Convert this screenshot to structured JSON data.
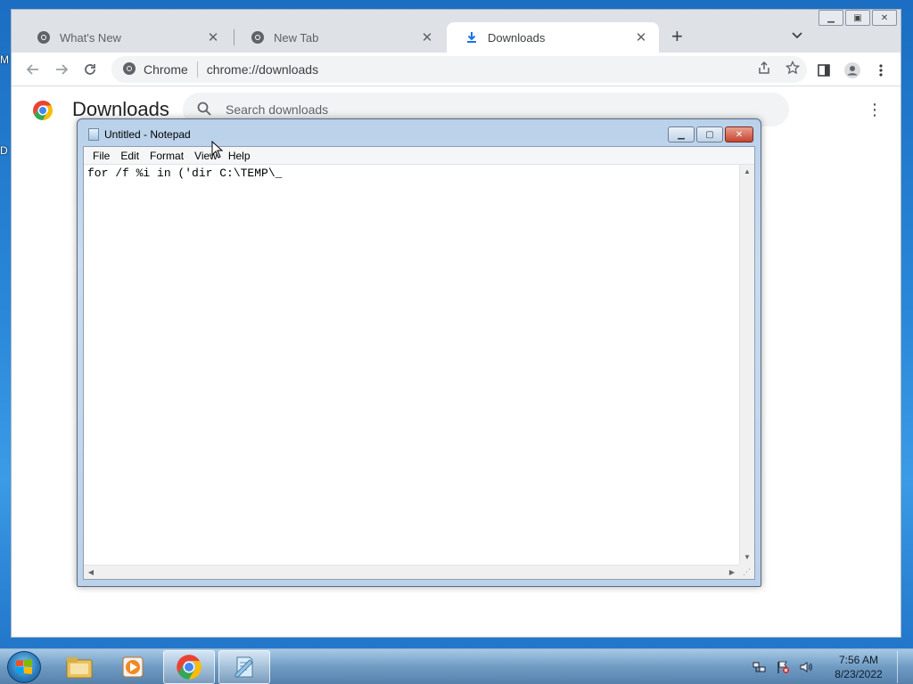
{
  "chrome": {
    "tabs": [
      {
        "label": "What's New",
        "icon": "chrome-icon",
        "active": false
      },
      {
        "label": "New Tab",
        "icon": "chrome-icon",
        "active": false
      },
      {
        "label": "Downloads",
        "icon": "download-icon",
        "active": true
      }
    ],
    "close_glyph": "✕",
    "new_tab_glyph": "+",
    "tab_search_glyph": "⌄",
    "omnibox": {
      "site_label": "Chrome",
      "url": "chrome://downloads"
    }
  },
  "downloads": {
    "title": "Downloads",
    "search_placeholder": "Search downloads",
    "menu_glyph": "⋮"
  },
  "notepad": {
    "title": "Untitled - Notepad",
    "menu": [
      "File",
      "Edit",
      "Format",
      "View",
      "Help"
    ],
    "text": "for /f %i in ('dir C:\\TEMP\\_"
  },
  "taskbar": {
    "items": [
      "file-explorer-icon",
      "media-player-icon",
      "chrome-icon",
      "notepad-icon"
    ],
    "active_items": [
      "chrome-icon",
      "notepad-icon"
    ],
    "clock_time": "7:56 AM",
    "clock_date": "8/23/2022"
  },
  "desktop": {
    "peek_letters": [
      "M",
      "D"
    ]
  },
  "colors": {
    "chrome_tabstrip": "#dee1e6",
    "chrome_download_accent": "#1a73e8",
    "notepad_close": "#c44530",
    "desktop_blue": "#2a87d8"
  }
}
